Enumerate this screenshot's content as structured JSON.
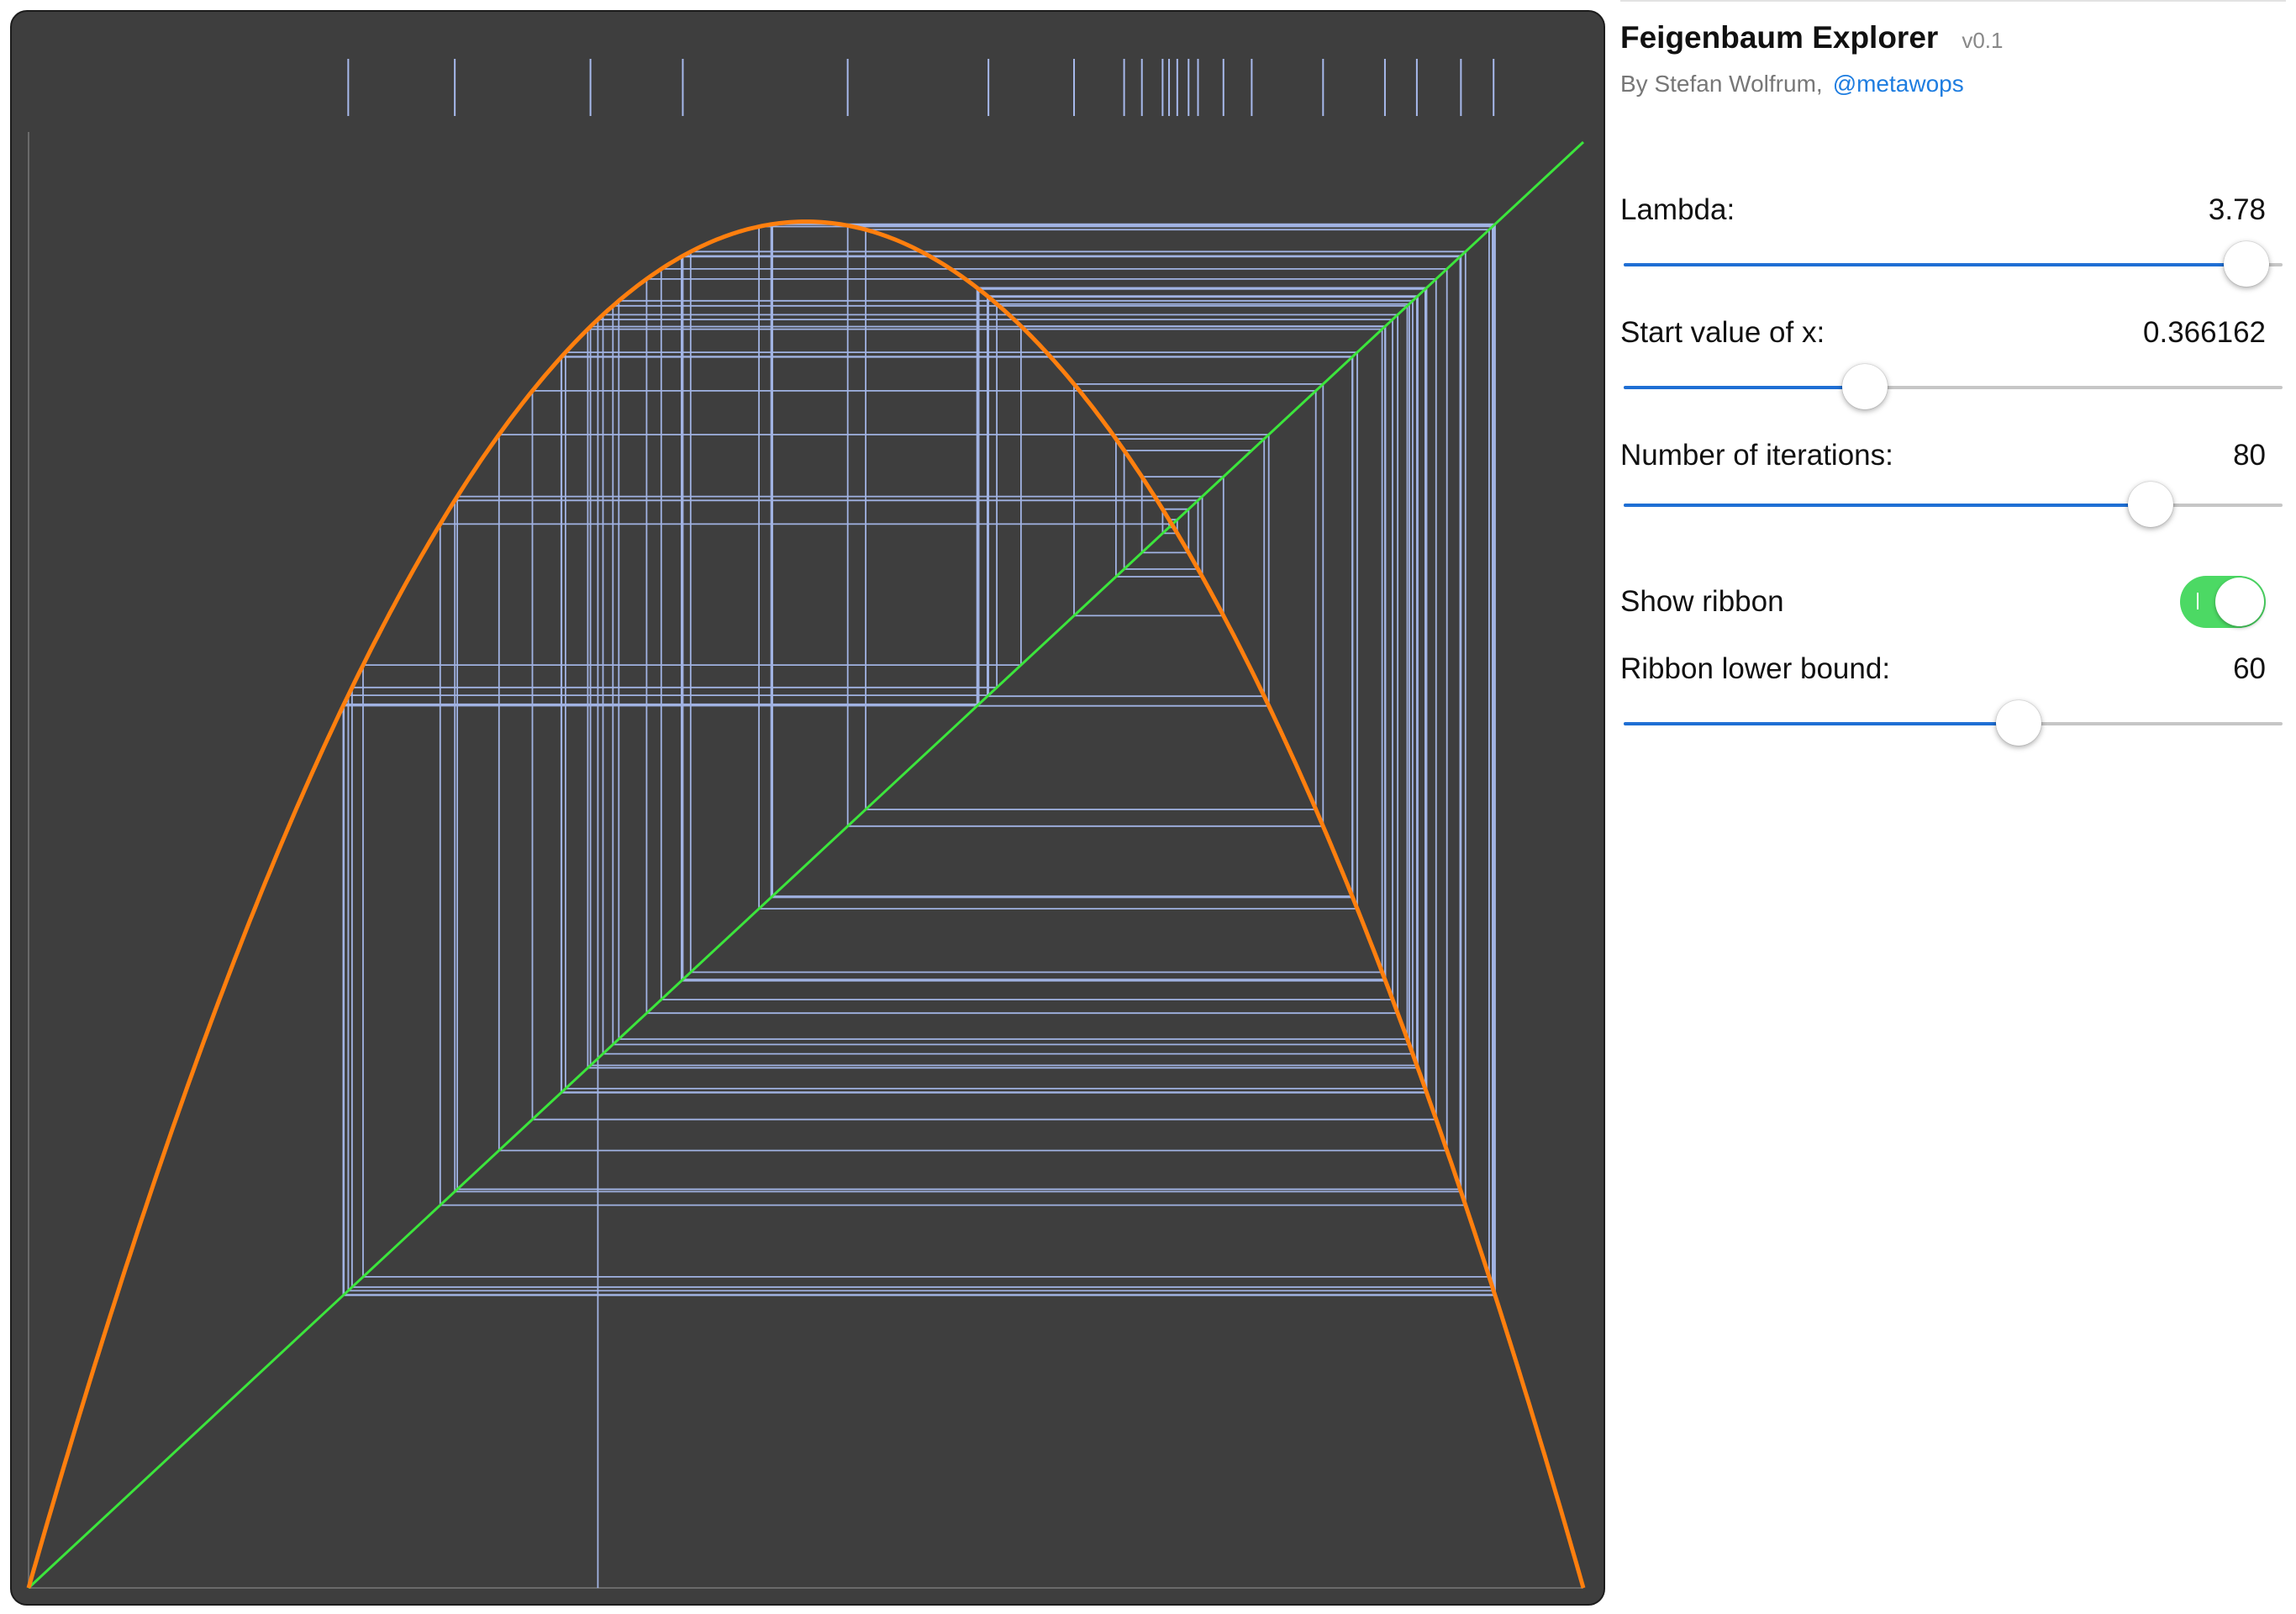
{
  "app": {
    "title": "Feigenbaum Explorer",
    "version": "v0.1",
    "byline_prefix": "By Stefan Wolfrum,",
    "byline_handle": "@metawops"
  },
  "controls": {
    "lambda": {
      "label": "Lambda:",
      "value": "3.78",
      "min": 0,
      "max": 4,
      "position": 3.78
    },
    "start_x": {
      "label": "Start value of x:",
      "value": "0.366162",
      "min": 0,
      "max": 1,
      "position": 0.366162
    },
    "iterations": {
      "label": "Number of iterations:",
      "value": "80",
      "min": 0,
      "max": 100,
      "position": 80
    },
    "show_ribbon": {
      "label": "Show ribbon",
      "on": true
    },
    "ribbon_lower": {
      "label": "Ribbon lower bound:",
      "value": "60",
      "min": 0,
      "max": 100,
      "position": 60
    }
  },
  "colors": {
    "canvas_bg": "#3e3e3e",
    "curve": "#ff7f0e",
    "diagonal": "#3ce53c",
    "cobweb": "#a7b9ec",
    "ribbon_tick": "#a7b9ec",
    "axis": "#6a6a6a",
    "slider_fill": "#1f6fd4",
    "toggle_on": "#4cd964",
    "link": "#1e7de0"
  },
  "chart_data": {
    "type": "line",
    "title": "",
    "xlabel": "",
    "ylabel": "",
    "xlim": [
      0,
      1
    ],
    "ylim": [
      0,
      1
    ],
    "series": [
      {
        "kind": "logistic-map",
        "formula": "lambda * x * (1 - x)"
      },
      {
        "kind": "identity",
        "formula": "x"
      },
      {
        "kind": "cobweb",
        "lambda": 3.78,
        "x0": 0.366162,
        "iterations": 80
      },
      {
        "kind": "ribbon",
        "from_iteration": 60,
        "to_iteration": 80
      }
    ]
  }
}
